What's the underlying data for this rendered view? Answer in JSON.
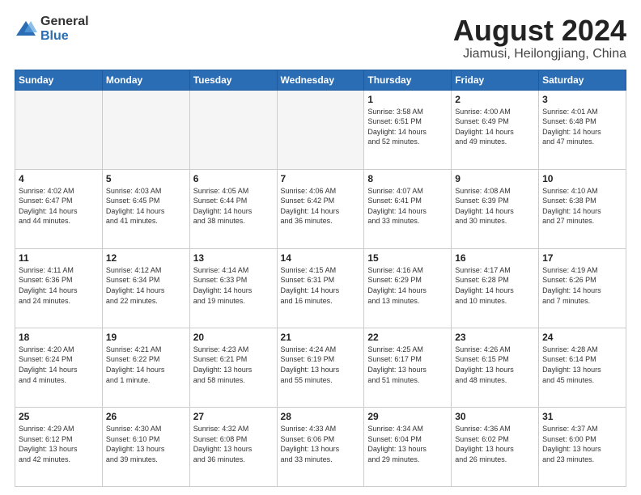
{
  "logo": {
    "general": "General",
    "blue": "Blue"
  },
  "title": {
    "month_year": "August 2024",
    "location": "Jiamusi, Heilongjiang, China"
  },
  "weekdays": [
    "Sunday",
    "Monday",
    "Tuesday",
    "Wednesday",
    "Thursday",
    "Friday",
    "Saturday"
  ],
  "weeks": [
    [
      {
        "day": "",
        "info": ""
      },
      {
        "day": "",
        "info": ""
      },
      {
        "day": "",
        "info": ""
      },
      {
        "day": "",
        "info": ""
      },
      {
        "day": "1",
        "info": "Sunrise: 3:58 AM\nSunset: 6:51 PM\nDaylight: 14 hours\nand 52 minutes."
      },
      {
        "day": "2",
        "info": "Sunrise: 4:00 AM\nSunset: 6:49 PM\nDaylight: 14 hours\nand 49 minutes."
      },
      {
        "day": "3",
        "info": "Sunrise: 4:01 AM\nSunset: 6:48 PM\nDaylight: 14 hours\nand 47 minutes."
      }
    ],
    [
      {
        "day": "4",
        "info": "Sunrise: 4:02 AM\nSunset: 6:47 PM\nDaylight: 14 hours\nand 44 minutes."
      },
      {
        "day": "5",
        "info": "Sunrise: 4:03 AM\nSunset: 6:45 PM\nDaylight: 14 hours\nand 41 minutes."
      },
      {
        "day": "6",
        "info": "Sunrise: 4:05 AM\nSunset: 6:44 PM\nDaylight: 14 hours\nand 38 minutes."
      },
      {
        "day": "7",
        "info": "Sunrise: 4:06 AM\nSunset: 6:42 PM\nDaylight: 14 hours\nand 36 minutes."
      },
      {
        "day": "8",
        "info": "Sunrise: 4:07 AM\nSunset: 6:41 PM\nDaylight: 14 hours\nand 33 minutes."
      },
      {
        "day": "9",
        "info": "Sunrise: 4:08 AM\nSunset: 6:39 PM\nDaylight: 14 hours\nand 30 minutes."
      },
      {
        "day": "10",
        "info": "Sunrise: 4:10 AM\nSunset: 6:38 PM\nDaylight: 14 hours\nand 27 minutes."
      }
    ],
    [
      {
        "day": "11",
        "info": "Sunrise: 4:11 AM\nSunset: 6:36 PM\nDaylight: 14 hours\nand 24 minutes."
      },
      {
        "day": "12",
        "info": "Sunrise: 4:12 AM\nSunset: 6:34 PM\nDaylight: 14 hours\nand 22 minutes."
      },
      {
        "day": "13",
        "info": "Sunrise: 4:14 AM\nSunset: 6:33 PM\nDaylight: 14 hours\nand 19 minutes."
      },
      {
        "day": "14",
        "info": "Sunrise: 4:15 AM\nSunset: 6:31 PM\nDaylight: 14 hours\nand 16 minutes."
      },
      {
        "day": "15",
        "info": "Sunrise: 4:16 AM\nSunset: 6:29 PM\nDaylight: 14 hours\nand 13 minutes."
      },
      {
        "day": "16",
        "info": "Sunrise: 4:17 AM\nSunset: 6:28 PM\nDaylight: 14 hours\nand 10 minutes."
      },
      {
        "day": "17",
        "info": "Sunrise: 4:19 AM\nSunset: 6:26 PM\nDaylight: 14 hours\nand 7 minutes."
      }
    ],
    [
      {
        "day": "18",
        "info": "Sunrise: 4:20 AM\nSunset: 6:24 PM\nDaylight: 14 hours\nand 4 minutes."
      },
      {
        "day": "19",
        "info": "Sunrise: 4:21 AM\nSunset: 6:22 PM\nDaylight: 14 hours\nand 1 minute."
      },
      {
        "day": "20",
        "info": "Sunrise: 4:23 AM\nSunset: 6:21 PM\nDaylight: 13 hours\nand 58 minutes."
      },
      {
        "day": "21",
        "info": "Sunrise: 4:24 AM\nSunset: 6:19 PM\nDaylight: 13 hours\nand 55 minutes."
      },
      {
        "day": "22",
        "info": "Sunrise: 4:25 AM\nSunset: 6:17 PM\nDaylight: 13 hours\nand 51 minutes."
      },
      {
        "day": "23",
        "info": "Sunrise: 4:26 AM\nSunset: 6:15 PM\nDaylight: 13 hours\nand 48 minutes."
      },
      {
        "day": "24",
        "info": "Sunrise: 4:28 AM\nSunset: 6:14 PM\nDaylight: 13 hours\nand 45 minutes."
      }
    ],
    [
      {
        "day": "25",
        "info": "Sunrise: 4:29 AM\nSunset: 6:12 PM\nDaylight: 13 hours\nand 42 minutes."
      },
      {
        "day": "26",
        "info": "Sunrise: 4:30 AM\nSunset: 6:10 PM\nDaylight: 13 hours\nand 39 minutes."
      },
      {
        "day": "27",
        "info": "Sunrise: 4:32 AM\nSunset: 6:08 PM\nDaylight: 13 hours\nand 36 minutes."
      },
      {
        "day": "28",
        "info": "Sunrise: 4:33 AM\nSunset: 6:06 PM\nDaylight: 13 hours\nand 33 minutes."
      },
      {
        "day": "29",
        "info": "Sunrise: 4:34 AM\nSunset: 6:04 PM\nDaylight: 13 hours\nand 29 minutes."
      },
      {
        "day": "30",
        "info": "Sunrise: 4:36 AM\nSunset: 6:02 PM\nDaylight: 13 hours\nand 26 minutes."
      },
      {
        "day": "31",
        "info": "Sunrise: 4:37 AM\nSunset: 6:00 PM\nDaylight: 13 hours\nand 23 minutes."
      }
    ]
  ]
}
